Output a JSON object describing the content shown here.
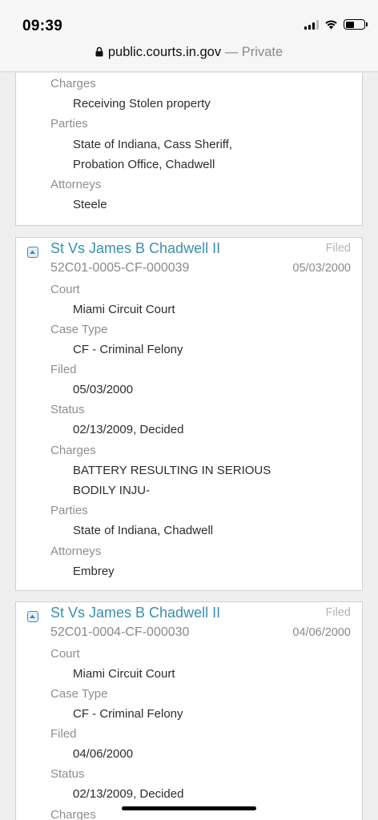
{
  "status_bar": {
    "time": "09:39"
  },
  "browser": {
    "domain": "public.courts.in.gov",
    "separator": " — ",
    "mode": "Private"
  },
  "cases": [
    {
      "fields": [
        {
          "label": "Charges",
          "values": [
            "Receiving Stolen property"
          ]
        },
        {
          "label": "Parties",
          "values": [
            "State of Indiana, Cass Sheriff,",
            "Probation Office, Chadwell"
          ]
        },
        {
          "label": "Attorneys",
          "values": [
            "Steele"
          ]
        }
      ]
    },
    {
      "title": "St Vs James B Chadwell II",
      "case_number": "52C01-0005-CF-000039",
      "filed_label": "Filed",
      "filed_date": "05/03/2000",
      "fields": [
        {
          "label": "Court",
          "values": [
            "Miami Circuit Court"
          ]
        },
        {
          "label": "Case Type",
          "values": [
            "CF - Criminal Felony"
          ]
        },
        {
          "label": "Filed",
          "values": [
            "05/03/2000"
          ]
        },
        {
          "label": "Status",
          "values": [
            "02/13/2009, Decided"
          ]
        },
        {
          "label": "Charges",
          "values": [
            "BATTERY RESULTING IN SERIOUS",
            "BODILY INJU-"
          ]
        },
        {
          "label": "Parties",
          "values": [
            "State of Indiana, Chadwell"
          ]
        },
        {
          "label": "Attorneys",
          "values": [
            "Embrey"
          ]
        }
      ]
    },
    {
      "title": "St Vs James B Chadwell II",
      "case_number": "52C01-0004-CF-000030",
      "filed_label": "Filed",
      "filed_date": "04/06/2000",
      "fields": [
        {
          "label": "Court",
          "values": [
            "Miami Circuit Court"
          ]
        },
        {
          "label": "Case Type",
          "values": [
            "CF - Criminal Felony"
          ]
        },
        {
          "label": "Filed",
          "values": [
            "04/06/2000"
          ]
        },
        {
          "label": "Status",
          "values": [
            "02/13/2009, Decided"
          ]
        },
        {
          "label": "Charges",
          "values": []
        }
      ]
    }
  ],
  "colors": {
    "link": "#3b8fae",
    "label": "#8e8e8e",
    "text": "#2c2c2c"
  }
}
